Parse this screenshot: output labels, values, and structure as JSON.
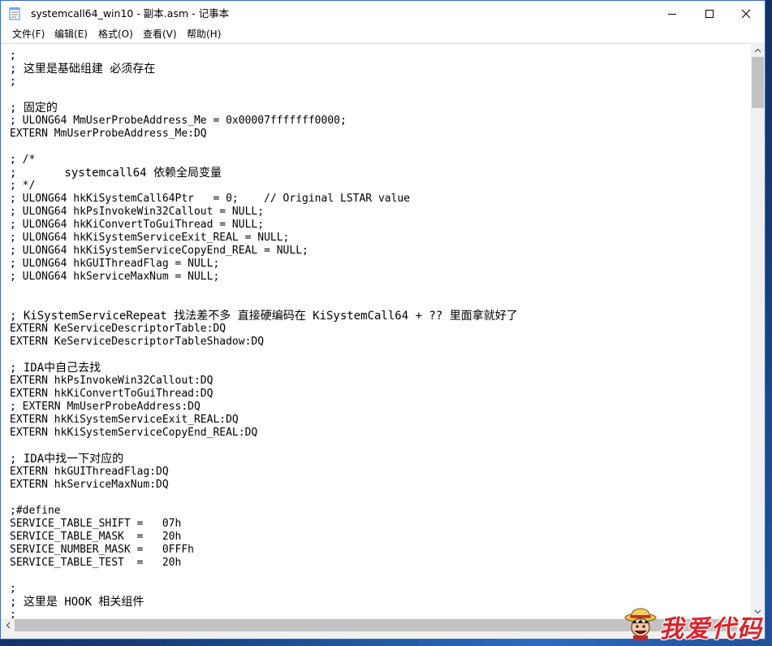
{
  "window": {
    "title": "systemcall64_win10 - 副本.asm - 记事本",
    "app_icon": "notepad-icon",
    "controls": {
      "minimize": "minimize-icon",
      "maximize": "maximize-icon",
      "close": "close-icon"
    }
  },
  "menu": {
    "items": [
      {
        "label": "文件(F)"
      },
      {
        "label": "编辑(E)"
      },
      {
        "label": "格式(O)"
      },
      {
        "label": "查看(V)"
      },
      {
        "label": "帮助(H)"
      }
    ]
  },
  "editor": {
    "lines": [
      ";",
      "; 这里是基础组建 必须存在",
      ";",
      "",
      "; 固定的",
      "; ULONG64 MmUserProbeAddress_Me = 0x00007fffffff0000;",
      "EXTERN MmUserProbeAddress_Me:DQ",
      "",
      "; /*",
      ";       systemcall64 依赖全局变量",
      "; */",
      "; ULONG64 hkKiSystemCall64Ptr   = 0;    // Original LSTAR value",
      "; ULONG64 hkPsInvokeWin32Callout = NULL;",
      "; ULONG64 hkKiConvertToGuiThread = NULL;",
      "; ULONG64 hkKiSystemServiceExit_REAL = NULL;",
      "; ULONG64 hkKiSystemServiceCopyEnd_REAL = NULL;",
      "; ULONG64 hkGUIThreadFlag = NULL;",
      "; ULONG64 hkServiceMaxNum = NULL;",
      "",
      "",
      "; KiSystemServiceRepeat 找法差不多 直接硬编码在 KiSystemCall64 + ?? 里面拿就好了",
      "EXTERN KeServiceDescriptorTable:DQ",
      "EXTERN KeServiceDescriptorTableShadow:DQ",
      "",
      "; IDA中自己去找",
      "EXTERN hkPsInvokeWin32Callout:DQ",
      "EXTERN hkKiConvertToGuiThread:DQ",
      "; EXTERN MmUserProbeAddress:DQ",
      "EXTERN hkKiSystemServiceExit_REAL:DQ",
      "EXTERN hkKiSystemServiceCopyEnd_REAL:DQ",
      "",
      "; IDA中找一下对应的",
      "EXTERN hkGUIThreadFlag:DQ",
      "EXTERN hkServiceMaxNum:DQ",
      "",
      ";#define",
      "SERVICE_TABLE_SHIFT =   07h",
      "SERVICE_TABLE_MASK  =   20h",
      "SERVICE_NUMBER_MASK =   0FFFh",
      "SERVICE_TABLE_TEST  =   20h",
      "",
      ";",
      "; 这里是 HOOK 相关组件",
      ";"
    ]
  },
  "watermark": {
    "text": "我爱代码",
    "mascot_icon": "straw-hat-mascot-icon"
  },
  "colors": {
    "watermark": "#d8252b",
    "scrollbar_thumb": "#c2c2c2",
    "desktop": "#1f4a8a"
  }
}
